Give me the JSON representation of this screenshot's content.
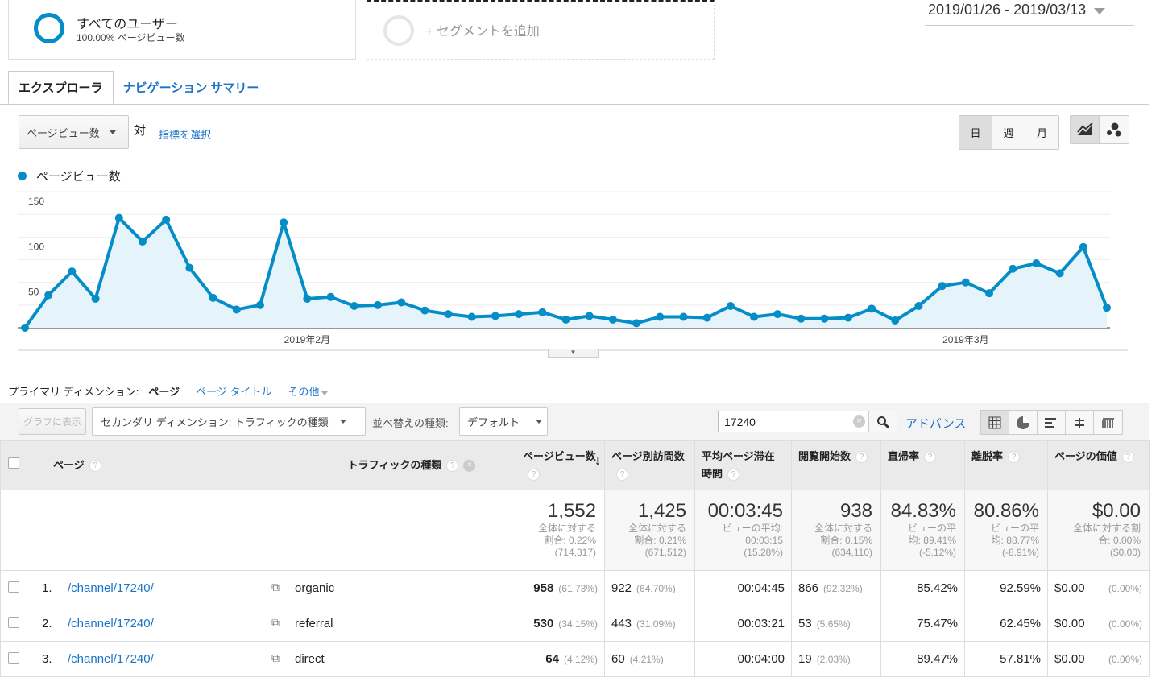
{
  "segments": [
    {
      "title": "すべてのユーザー",
      "subtitle": "100.00% ページビュー数"
    },
    {
      "title": "+ セグメントを追加"
    }
  ],
  "date_range": "2019/01/26 - 2019/03/13",
  "tabs": [
    {
      "label": "エクスプローラ",
      "active": true
    },
    {
      "label": "ナビゲーション サマリー",
      "active": false
    }
  ],
  "metric_selector": {
    "value": "ページビュー数",
    "vs": "対",
    "select_metric": "指標を選択"
  },
  "granularity": [
    {
      "label": "日",
      "active": true
    },
    {
      "label": "週"
    },
    {
      "label": "月"
    }
  ],
  "chart_type_icons": [
    "line-chart-icon",
    "motion-chart-icon"
  ],
  "colors": {
    "accent": "#058dc7",
    "fill": "#e5f3fb",
    "link": "#1a73c8"
  },
  "chart_data": {
    "type": "area",
    "legend": "ページビュー数",
    "legend_placement": "top-left",
    "x_start": "2019-01-26",
    "x_end": "2019-03-13",
    "x_tick_labels": [
      {
        "date": "2019-02-01",
        "label": "2019年2月"
      },
      {
        "date": "2019-03-01",
        "label": "2019年3月"
      }
    ],
    "y_ticks": [
      50,
      100,
      150
    ],
    "ylim": [
      0,
      150
    ],
    "grid": true,
    "values": [
      0,
      36,
      62,
      32,
      121,
      95,
      119,
      66,
      33,
      20,
      25,
      116,
      32,
      34,
      24,
      25,
      28,
      19,
      15,
      12,
      13,
      15,
      17,
      9,
      13,
      9,
      5,
      12,
      12,
      11,
      24,
      12,
      15,
      10,
      10,
      11,
      21,
      8,
      24,
      46,
      50,
      38,
      65,
      71,
      60,
      89,
      22
    ]
  },
  "dimension": {
    "label": "プライマリ ディメンション:",
    "current": "ページ",
    "options": [
      "ページ タイトル",
      "その他"
    ]
  },
  "toolbar": {
    "plot_rows": "グラフに表示",
    "secondary": "セカンダリ ディメンション: トラフィックの種類",
    "sort_label": "並べ替えの種類:",
    "sort_value": "デフォルト",
    "search_value": "17240",
    "advanced": "アドバンス"
  },
  "view_icons": [
    "table-view-icon",
    "pie-view-icon",
    "performance-view-icon",
    "comparison-view-icon",
    "pivot-view-icon"
  ],
  "table": {
    "headers": [
      "ページ",
      "トラフィックの種類",
      "ページビュー数",
      "ページ別訪問数",
      "平均ページ滞在時間",
      "閲覧開始数",
      "直帰率",
      "離脱率",
      "ページの価値"
    ],
    "totals": [
      {
        "value": "1,552",
        "l1": "全体に対する",
        "l2": "割合: 0.22%",
        "l3": "(714,317)"
      },
      {
        "value": "1,425",
        "l1": "全体に対する",
        "l2": "割合: 0.21%",
        "l3": "(671,512)"
      },
      {
        "value": "00:03:45",
        "l1": "ビューの平均:",
        "l2": "00:03:15",
        "l3": "(15.28%)"
      },
      {
        "value": "938",
        "l1": "全体に対する",
        "l2": "割合: 0.15%",
        "l3": "(634,110)"
      },
      {
        "value": "84.83%",
        "l1": "ビューの平",
        "l2": "均: 89.41%",
        "l3": "(-5.12%)"
      },
      {
        "value": "80.86%",
        "l1": "ビューの平",
        "l2": "均: 88.77%",
        "l3": "(-8.91%)"
      },
      {
        "value": "$0.00",
        "l1": "全体に対する割",
        "l2": "合: 0.00%",
        "l3": "($0.00)"
      }
    ],
    "rows": [
      {
        "idx": "1.",
        "page": "/channel/17240/",
        "traffic": "organic",
        "pv": "958",
        "pv_pct": "(61.73%)",
        "upv": "922",
        "upv_pct": "(64.70%)",
        "time": "00:04:45",
        "ent": "866",
        "ent_pct": "(92.32%)",
        "bounce": "85.42%",
        "exit": "92.59%",
        "val": "$0.00",
        "val_pct": "(0.00%)"
      },
      {
        "idx": "2.",
        "page": "/channel/17240/",
        "traffic": "referral",
        "pv": "530",
        "pv_pct": "(34.15%)",
        "upv": "443",
        "upv_pct": "(31.09%)",
        "time": "00:03:21",
        "ent": "53",
        "ent_pct": "(5.65%)",
        "bounce": "75.47%",
        "exit": "62.45%",
        "val": "$0.00",
        "val_pct": "(0.00%)"
      },
      {
        "idx": "3.",
        "page": "/channel/17240/",
        "traffic": "direct",
        "pv": "64",
        "pv_pct": "(4.12%)",
        "upv": "60",
        "upv_pct": "(4.21%)",
        "time": "00:04:00",
        "ent": "19",
        "ent_pct": "(2.03%)",
        "bounce": "89.47%",
        "exit": "57.81%",
        "val": "$0.00",
        "val_pct": "(0.00%)"
      }
    ]
  }
}
